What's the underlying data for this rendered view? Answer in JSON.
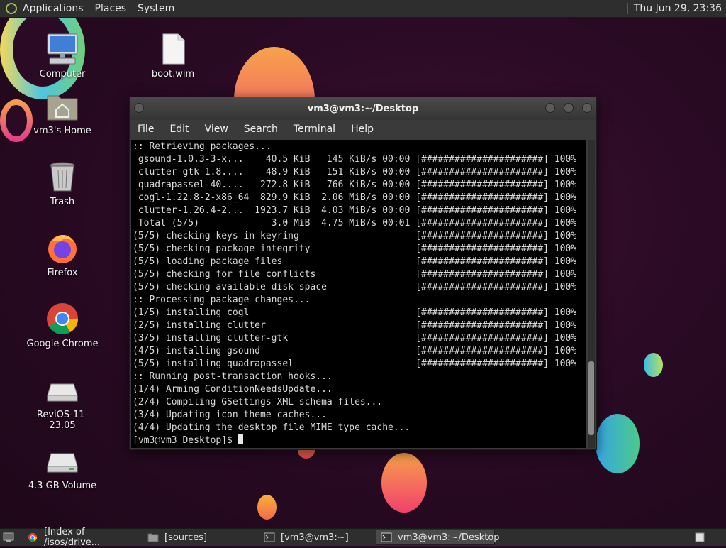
{
  "top_panel": {
    "menus": [
      "Applications",
      "Places",
      "System"
    ],
    "clock": "Thu Jun 29, 23:36"
  },
  "desktop_icons": [
    {
      "label": "Computer",
      "icon": "computer-icon"
    },
    {
      "label": "boot.wim",
      "icon": "file-icon"
    },
    {
      "label": "vm3's Home",
      "icon": "home-folder-icon"
    },
    {
      "label": "Trash",
      "icon": "trash-icon"
    },
    {
      "label": "Firefox",
      "icon": "firefox-icon"
    },
    {
      "label": "Google Chrome",
      "icon": "chrome-icon"
    },
    {
      "label": "ReviOS-11-23.05",
      "icon": "drive-icon"
    },
    {
      "label": "4.3 GB Volume",
      "icon": "drive-icon"
    }
  ],
  "terminal": {
    "title": "vm3@vm3:~/Desktop",
    "menu": [
      "File",
      "Edit",
      "View",
      "Search",
      "Terminal",
      "Help"
    ],
    "lines": [
      ":: Retrieving packages...",
      " gsound-1.0.3-3-x...    40.5 KiB   145 KiB/s 00:00 [######################] 100%",
      " clutter-gtk-1.8....    48.9 KiB   151 KiB/s 00:00 [######################] 100%",
      " quadrapassel-40....   272.8 KiB   766 KiB/s 00:00 [######################] 100%",
      " cogl-1.22.8-2-x86_64  829.9 KiB  2.06 MiB/s 00:00 [######################] 100%",
      " clutter-1.26.4-2...  1923.7 KiB  4.03 MiB/s 00:00 [######################] 100%",
      " Total (5/5)             3.0 MiB  4.75 MiB/s 00:01 [######################] 100%",
      "(5/5) checking keys in keyring                     [######################] 100%",
      "(5/5) checking package integrity                   [######################] 100%",
      "(5/5) loading package files                        [######################] 100%",
      "(5/5) checking for file conflicts                  [######################] 100%",
      "(5/5) checking available disk space                [######################] 100%",
      ":: Processing package changes...",
      "(1/5) installing cogl                              [######################] 100%",
      "(2/5) installing clutter                           [######################] 100%",
      "(3/5) installing clutter-gtk                       [######################] 100%",
      "(4/5) installing gsound                            [######################] 100%",
      "(5/5) installing quadrapassel                      [######################] 100%",
      ":: Running post-transaction hooks...",
      "(1/4) Arming ConditionNeedsUpdate...",
      "(2/4) Compiling GSettings XML schema files...",
      "(3/4) Updating icon theme caches...",
      "(4/4) Updating the desktop file MIME type cache..."
    ],
    "prompt": "[vm3@vm3 Desktop]$ "
  },
  "taskbar": {
    "tasks": [
      {
        "label": "[Index of /isos/drive...",
        "icon": "chrome-icon",
        "active": false
      },
      {
        "label": "[sources]",
        "icon": "folder-icon",
        "active": false
      },
      {
        "label": "[vm3@vm3:~]",
        "icon": "terminal-icon",
        "active": false
      },
      {
        "label": "vm3@vm3:~/Desktop",
        "icon": "terminal-icon",
        "active": true
      }
    ]
  }
}
